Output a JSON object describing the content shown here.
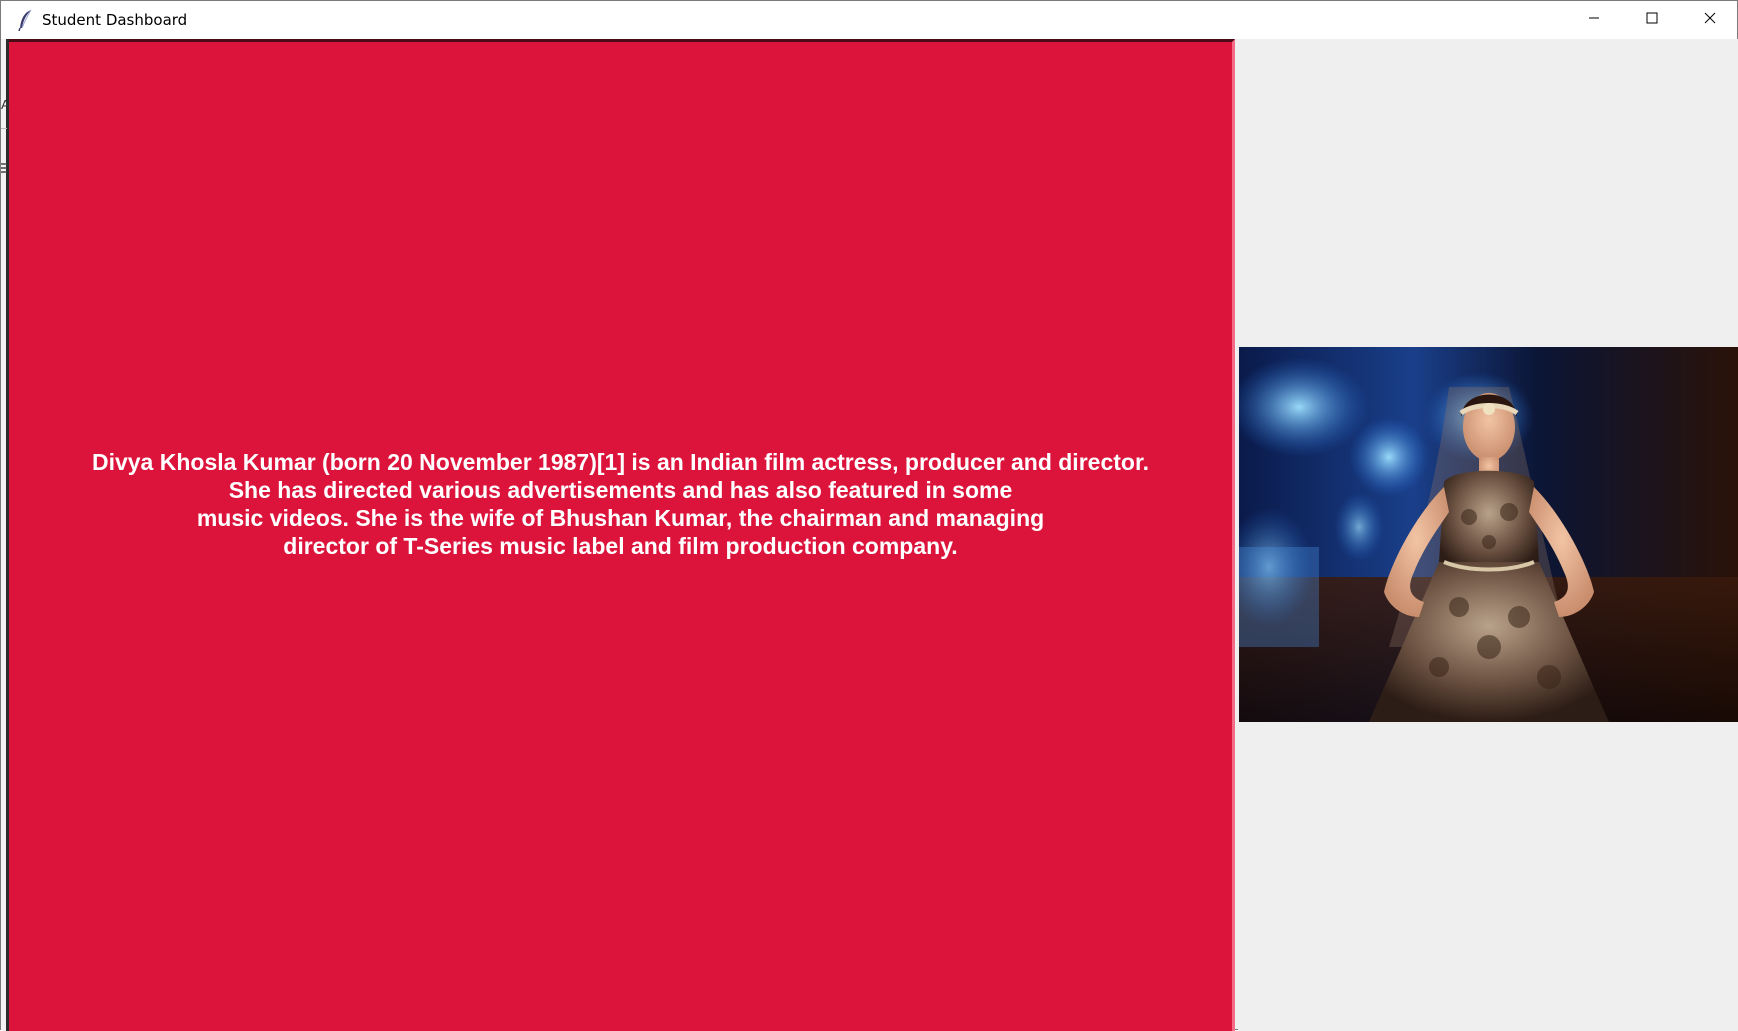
{
  "window": {
    "title": "Student Dashboard",
    "icons": {
      "app": "feather-icon",
      "minimize": "minimize-icon",
      "maximize": "maximize-icon",
      "close": "close-icon"
    }
  },
  "main": {
    "bio_text": "Divya Khosla Kumar (born 20 November 1987)[1] is an Indian film actress, producer and director.\nShe has directed various advertisements and has also featured in some\nmusic videos. She is the wife of Bhushan Kumar, the chairman and managing\ndirector of T-Series music label and film production company.",
    "panel_color": "#dc143c",
    "text_color": "#ffffff"
  },
  "side": {
    "photo_icon": "photo-image"
  },
  "edge_fragments": {
    "letter": "A"
  }
}
